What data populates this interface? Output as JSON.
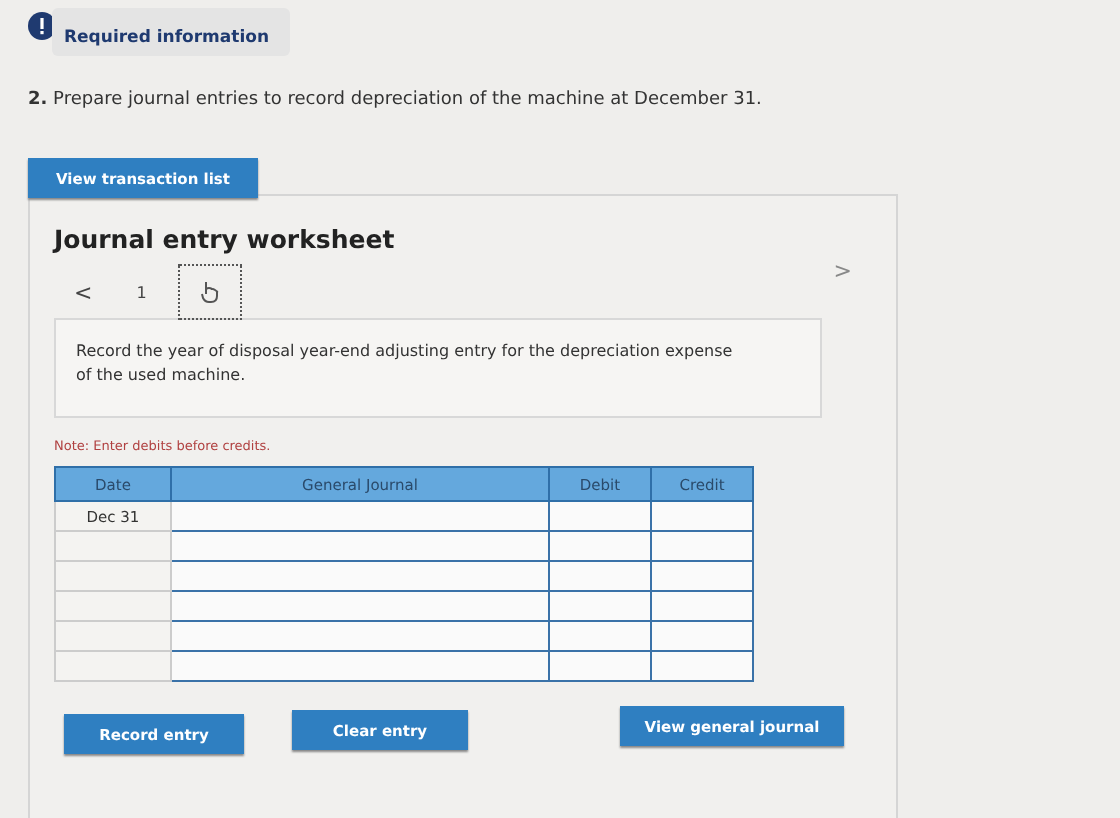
{
  "required_info": {
    "label": "Required information"
  },
  "question": {
    "number": "2.",
    "text": "Prepare journal entries to record depreciation of the machine at December 31."
  },
  "view_transactions_button": "View transaction list",
  "worksheet": {
    "title": "Journal entry worksheet",
    "pager": {
      "prev": "<",
      "page": "1",
      "next": ">"
    },
    "instruction": "Record the year of disposal year-end adjusting entry for the depreciation expense of the used machine.",
    "note": "Note: Enter debits before credits.",
    "table": {
      "columns": [
        "Date",
        "General Journal",
        "Debit",
        "Credit"
      ],
      "rows": [
        {
          "date": "Dec 31"
        },
        {},
        {},
        {},
        {},
        {}
      ]
    },
    "buttons": [
      "Record entry",
      "Clear entry",
      "View general journal"
    ]
  }
}
